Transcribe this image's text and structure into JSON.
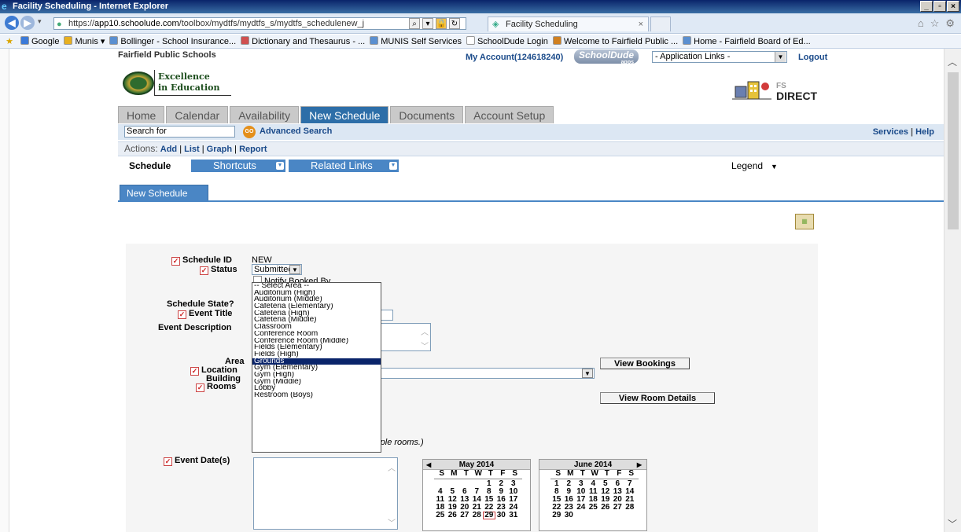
{
  "browser": {
    "window_title": "Facility Scheduling - Internet Explorer",
    "url_prefix": "https://",
    "url_host": "app10.schoolude.com",
    "url_path": "/toolbox/mydtfs/mydtfs_s/mydtfs_schedulenew_j",
    "tab_title": "Facility Scheduling",
    "tab_close": "×",
    "favorites": [
      {
        "label": "Google",
        "color": "#3b7ad9"
      },
      {
        "label": "Munis ▾",
        "color": "#e8b020"
      },
      {
        "label": "Bollinger - School Insurance...",
        "color": "#5a8fd0"
      },
      {
        "label": "Dictionary and Thesaurus - ...",
        "color": "#d05050"
      },
      {
        "label": "MUNIS Self Services",
        "color": "#5a8fd0"
      },
      {
        "label": "SchoolDude Login",
        "color": "#ffffff"
      },
      {
        "label": "Welcome to Fairfield Public ...",
        "color": "#d08020"
      },
      {
        "label": "Home - Fairfield Board of Ed...",
        "color": "#5a8fd0"
      }
    ]
  },
  "header": {
    "org_name": "Fairfield Public Schools",
    "account": "My Account(124618240)",
    "schooldude_logo": "SchoolDude",
    "schooldude_sub": "apps",
    "app_links": "- Application Links -",
    "logout": "Logout",
    "motto_line1": "Excellence",
    "motto_line2": "in Education",
    "fs": "FS",
    "direct": "DIRECT"
  },
  "nav": {
    "tabs": [
      "Home",
      "Calendar",
      "Availability",
      "New Schedule",
      "Documents",
      "Account Setup"
    ],
    "active_tab": "New Schedule",
    "search_value": "Search for",
    "go_label": "GO",
    "advanced_search": "Advanced Search",
    "services": "Services",
    "help": "Help",
    "actions_label": "Actions:",
    "actions": [
      "Add",
      "List",
      "Graph",
      "Report"
    ],
    "schedule_label": "Schedule",
    "shortcuts": "Shortcuts",
    "related_links": "Related Links",
    "legend": "Legend",
    "subtab": "New Schedule"
  },
  "form": {
    "schedule_id_label": "Schedule ID",
    "schedule_id_value": "NEW",
    "status_label": "Status",
    "status_value": "Submitted",
    "notify_label": "Notify Booked By",
    "schedule_state_label": "Schedule State?",
    "event_title_label": "Event Title",
    "event_description_label": "Event Description",
    "area_label": "Area",
    "location_label": "Location",
    "building_label": "Building",
    "rooms_label": "Rooms",
    "view_bookings": "View Bookings",
    "view_room_details": "View Room Details",
    "rooms_hint": "(Use the CTRL key to select multiple rooms.)",
    "event_dates_label": "Event Date(s)",
    "area_options": [
      "-- Select Area --",
      "Auditorium (High)",
      "Auditorium (Middle)",
      "Cafeteria (Elementary)",
      "Cafeteria (High)",
      "Cafeteria (Middle)",
      "Classroom",
      "Conference Room",
      "Conference Room (Middle)",
      "Fields (Elementary)",
      "Fields (High)",
      "Grounds",
      "Gym (Elementary)",
      "Gym (High)",
      "Gym (Middle)",
      "Lobby",
      "Restroom (Boys)"
    ],
    "area_highlighted": "Grounds"
  },
  "calendars": [
    {
      "title": "May 2014",
      "dow": [
        "S",
        "M",
        "T",
        "W",
        "T",
        "F",
        "S"
      ],
      "weeks": [
        [
          "",
          "",
          "",
          "",
          "1",
          "2",
          "3"
        ],
        [
          "4",
          "5",
          "6",
          "7",
          "8",
          "9",
          "10"
        ],
        [
          "11",
          "12",
          "13",
          "14",
          "15",
          "16",
          "17"
        ],
        [
          "18",
          "19",
          "20",
          "21",
          "22",
          "23",
          "24"
        ],
        [
          "25",
          "26",
          "27",
          "28",
          "29",
          "30",
          "31"
        ]
      ],
      "today": "29"
    },
    {
      "title": "June 2014",
      "dow": [
        "S",
        "M",
        "T",
        "W",
        "T",
        "F",
        "S"
      ],
      "weeks": [
        [
          "1",
          "2",
          "3",
          "4",
          "5",
          "6",
          "7"
        ],
        [
          "8",
          "9",
          "10",
          "11",
          "12",
          "13",
          "14"
        ],
        [
          "15",
          "16",
          "17",
          "18",
          "19",
          "20",
          "21"
        ],
        [
          "22",
          "23",
          "24",
          "25",
          "26",
          "27",
          "28"
        ],
        [
          "29",
          "30",
          "",
          "",
          "",
          "",
          ""
        ]
      ],
      "today": ""
    }
  ]
}
